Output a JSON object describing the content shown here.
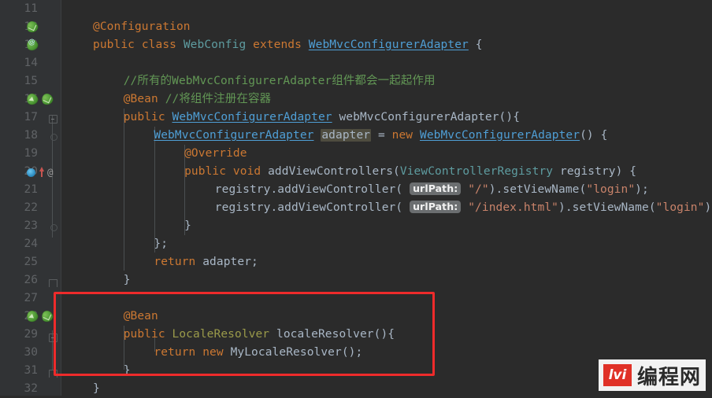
{
  "editor": {
    "theme_bg": "#2b2b2b",
    "gutter_bg": "#313335",
    "highlight_color": "#ee2b2b",
    "lines": [
      {
        "n": "11",
        "indent": 0,
        "segments": []
      },
      {
        "n": "12",
        "indent": 0,
        "segments": [
          {
            "t": "@Configuration",
            "c": "ann-o"
          }
        ]
      },
      {
        "n": "13",
        "indent": 0,
        "segments": [
          {
            "t": "public",
            "c": "kw"
          },
          {
            "t": " ",
            "c": "plain"
          },
          {
            "t": "class",
            "c": "kw"
          },
          {
            "t": " ",
            "c": "plain"
          },
          {
            "t": "WebConfig",
            "c": "typ"
          },
          {
            "t": " ",
            "c": "plain"
          },
          {
            "t": "extends",
            "c": "kw"
          },
          {
            "t": " ",
            "c": "plain"
          },
          {
            "t": "WebMvcConfigurerAdapter",
            "c": "cls"
          },
          {
            "t": " {",
            "c": "plain"
          }
        ]
      },
      {
        "n": "14",
        "indent": 0,
        "segments": []
      },
      {
        "n": "15",
        "indent": 1,
        "segments": [
          {
            "t": "//所有的WebMvcConfigurerAdapter组件都会一起起作用",
            "c": "cmt"
          }
        ]
      },
      {
        "n": "16",
        "indent": 1,
        "segments": [
          {
            "t": "@Bean",
            "c": "ann-o"
          },
          {
            "t": " ",
            "c": "plain"
          },
          {
            "t": "//将组件注册在容器",
            "c": "cmt"
          }
        ]
      },
      {
        "n": "17",
        "indent": 1,
        "segments": [
          {
            "t": "public",
            "c": "kw"
          },
          {
            "t": " ",
            "c": "plain"
          },
          {
            "t": "WebMvcConfigurerAdapter",
            "c": "cls"
          },
          {
            "t": " ",
            "c": "plain"
          },
          {
            "t": "webMvcConfigurerAdapter",
            "c": "plain"
          },
          {
            "t": "(){",
            "c": "plain"
          }
        ]
      },
      {
        "n": "18",
        "indent": 2,
        "segments": [
          {
            "t": "WebMvcConfigurerAdapter",
            "c": "cls"
          },
          {
            "t": " ",
            "c": "plain"
          },
          {
            "t": "adapter",
            "c": "plain hl"
          },
          {
            "t": " = ",
            "c": "plain"
          },
          {
            "t": "new",
            "c": "kw"
          },
          {
            "t": " ",
            "c": "plain"
          },
          {
            "t": "WebMvcConfigurerAdapter",
            "c": "cls"
          },
          {
            "t": "() {",
            "c": "plain"
          }
        ]
      },
      {
        "n": "19",
        "indent": 3,
        "segments": [
          {
            "t": "@Override",
            "c": "ann-o"
          }
        ]
      },
      {
        "n": "20",
        "indent": 3,
        "segments": [
          {
            "t": "public",
            "c": "kw"
          },
          {
            "t": " ",
            "c": "plain"
          },
          {
            "t": "void",
            "c": "kw"
          },
          {
            "t": " ",
            "c": "plain"
          },
          {
            "t": "addViewControllers",
            "c": "plain"
          },
          {
            "t": "(",
            "c": "plain"
          },
          {
            "t": "ViewControllerRegistry",
            "c": "typ"
          },
          {
            "t": " ",
            "c": "plain"
          },
          {
            "t": "registry",
            "c": "plain"
          },
          {
            "t": ") {",
            "c": "plain"
          }
        ]
      },
      {
        "n": "21",
        "indent": 4,
        "segments": [
          {
            "t": "registry",
            "c": "plain"
          },
          {
            "t": ".",
            "c": "plain"
          },
          {
            "t": "addViewController",
            "c": "plain"
          },
          {
            "t": "( ",
            "c": "plain"
          },
          {
            "t": "urlPath:",
            "c": "hint"
          },
          {
            "t": " ",
            "c": "plain"
          },
          {
            "t": "\"/\"",
            "c": "str"
          },
          {
            "t": ").",
            "c": "plain"
          },
          {
            "t": "setViewName",
            "c": "plain"
          },
          {
            "t": "(",
            "c": "plain"
          },
          {
            "t": "\"login\"",
            "c": "str"
          },
          {
            "t": ");",
            "c": "plain"
          }
        ]
      },
      {
        "n": "22",
        "indent": 4,
        "segments": [
          {
            "t": "registry",
            "c": "plain"
          },
          {
            "t": ".",
            "c": "plain"
          },
          {
            "t": "addViewController",
            "c": "plain"
          },
          {
            "t": "( ",
            "c": "plain"
          },
          {
            "t": "urlPath:",
            "c": "hint"
          },
          {
            "t": " ",
            "c": "plain"
          },
          {
            "t": "\"/index.html\"",
            "c": "str"
          },
          {
            "t": ").",
            "c": "plain"
          },
          {
            "t": "setViewName",
            "c": "plain"
          },
          {
            "t": "(",
            "c": "plain"
          },
          {
            "t": "\"login\"",
            "c": "str"
          },
          {
            "t": ");",
            "c": "plain"
          }
        ]
      },
      {
        "n": "23",
        "indent": 3,
        "segments": [
          {
            "t": "}",
            "c": "plain"
          }
        ]
      },
      {
        "n": "24",
        "indent": 2,
        "segments": [
          {
            "t": "};",
            "c": "plain"
          }
        ]
      },
      {
        "n": "25",
        "indent": 2,
        "segments": [
          {
            "t": "return",
            "c": "kw"
          },
          {
            "t": " ",
            "c": "plain"
          },
          {
            "t": "adapter",
            "c": "plain"
          },
          {
            "t": ";",
            "c": "plain"
          }
        ]
      },
      {
        "n": "26",
        "indent": 1,
        "segments": [
          {
            "t": "}",
            "c": "plain"
          }
        ]
      },
      {
        "n": "27",
        "indent": 0,
        "segments": []
      },
      {
        "n": "28",
        "indent": 1,
        "segments": [
          {
            "t": "@Bean",
            "c": "ann-o"
          }
        ]
      },
      {
        "n": "29",
        "indent": 1,
        "segments": [
          {
            "t": "public",
            "c": "kw"
          },
          {
            "t": " ",
            "c": "plain"
          },
          {
            "t": "LocaleResolver",
            "c": "ifc"
          },
          {
            "t": " ",
            "c": "plain"
          },
          {
            "t": "localeResolver",
            "c": "plain"
          },
          {
            "t": "(){",
            "c": "plain"
          }
        ]
      },
      {
        "n": "30",
        "indent": 2,
        "segments": [
          {
            "t": "return",
            "c": "kw"
          },
          {
            "t": " ",
            "c": "plain"
          },
          {
            "t": "new",
            "c": "kw"
          },
          {
            "t": " ",
            "c": "plain"
          },
          {
            "t": "MyLocaleResolver",
            "c": "plain"
          },
          {
            "t": "();",
            "c": "plain"
          }
        ]
      },
      {
        "n": "31",
        "indent": 1,
        "segments": [
          {
            "t": "}",
            "c": "plain"
          }
        ]
      },
      {
        "n": "32",
        "indent": 0,
        "segments": [
          {
            "t": "}",
            "c": "plain"
          }
        ]
      }
    ],
    "gutter_markers": [
      {
        "line": "12",
        "kind": "bean-ico",
        "label": "spring-bean-icon"
      },
      {
        "line": "13",
        "kind": "bean-ico bean-at",
        "label": "spring-config-icon"
      },
      {
        "line": "16",
        "kind": "bean-ico bean-arrow",
        "label": "spring-bean-navigate-icon"
      },
      {
        "line": "16",
        "kind": "bean-ico",
        "label": "spring-bean-icon"
      },
      {
        "line": "20",
        "kind": "ovr-ico",
        "label": "override-method-icon"
      },
      {
        "line": "28",
        "kind": "bean-ico bean-arrow",
        "label": "spring-bean-navigate-icon"
      },
      {
        "line": "28",
        "kind": "bean-ico",
        "label": "spring-bean-icon"
      }
    ],
    "annotation_at_symbol": "@"
  },
  "highlight_box": {
    "label": "red-annotation-rectangle",
    "color": "#ee2b2b",
    "covers_lines": "27-31"
  },
  "watermark": {
    "logo_text": "lvi",
    "site_name": "编程网"
  }
}
